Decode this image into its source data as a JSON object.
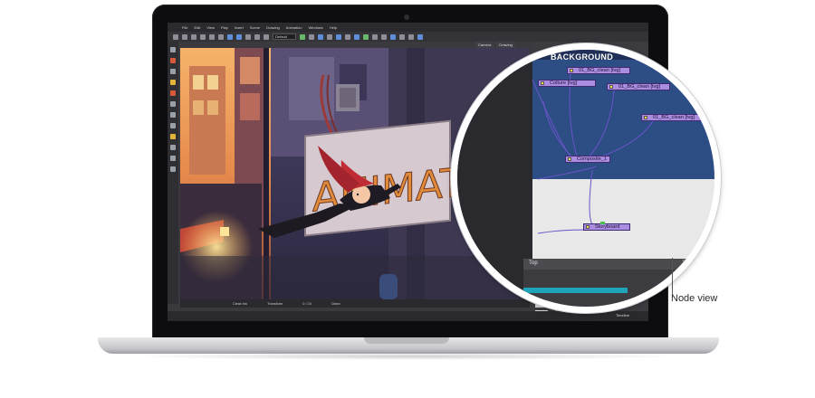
{
  "app": {
    "menu": [
      "File",
      "Edit",
      "View",
      "Play",
      "Insert",
      "Scene",
      "Drawing",
      "Animation",
      "Windows",
      "Help"
    ],
    "toolbar_select": "Default",
    "view_tabs": [
      "Camera",
      "Drawing"
    ],
    "status_items": [
      "Clean Ink",
      "Transform",
      "0 / 24"
    ],
    "status_zoom": "Clean",
    "timeline_rows": [
      "Base 0",
      "Bkkk"
    ],
    "bottom_tab": "Timeline"
  },
  "artwork": {
    "sign_text": "ANIMATION",
    "sign_text_lower": "ANIMATIO"
  },
  "node_view": {
    "group_title": "BACKGROUND",
    "nodes": [
      {
        "id": "n1",
        "label": "01_BG_clean [tvg]"
      },
      {
        "id": "n2",
        "label": "Colture [tvg]"
      },
      {
        "id": "n3",
        "label": "01_BG_clean [tvg]"
      },
      {
        "id": "n4",
        "label": "01_BG_clean [tvg]"
      },
      {
        "id": "n5",
        "label": "Composite_1"
      },
      {
        "id": "n6",
        "label": "Storyboard"
      }
    ],
    "search_text": "Top",
    "colors": {
      "group_bg": "#2d4d85",
      "node_fill": "#aa8de0",
      "port": "#f2e64a",
      "link": "#6a54c8"
    }
  },
  "callout_label": "Node view"
}
